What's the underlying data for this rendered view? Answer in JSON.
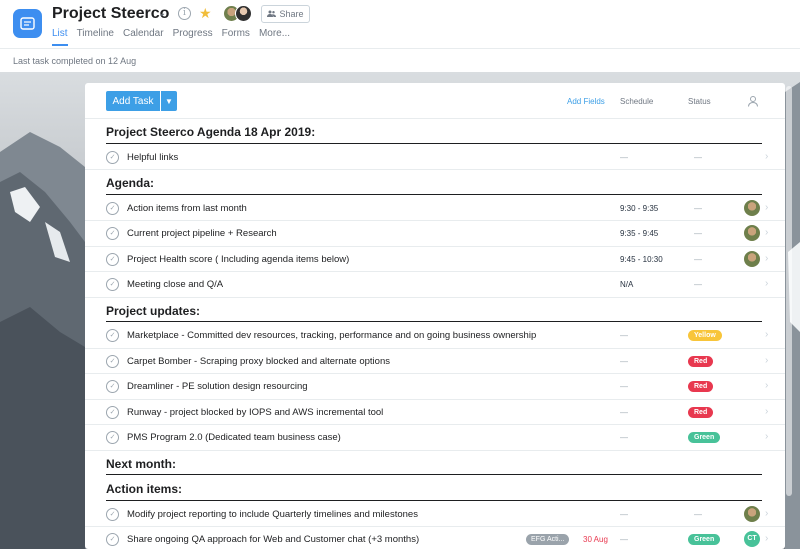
{
  "header": {
    "title": "Project Steerco",
    "share_label": "Share",
    "tabs": [
      {
        "label": "List"
      },
      {
        "label": "Timeline"
      },
      {
        "label": "Calendar"
      },
      {
        "label": "Progress"
      },
      {
        "label": "Forms"
      },
      {
        "label": "More..."
      }
    ],
    "active_tab": "List"
  },
  "subbar": {
    "last_completed": "Last task completed on 12 Aug"
  },
  "toolbar": {
    "add_task_label": "Add Task",
    "add_fields_label": "Add Fields",
    "schedule_label": "Schedule",
    "status_label": "Status"
  },
  "icons": {
    "app": "list-icon",
    "title_dropdown": "chevron-down-icon",
    "info": "info-icon",
    "favorite": "star-icon",
    "share": "people-icon",
    "assignee_header": "person-icon",
    "row_check": "check-icon",
    "row_details": "chevron-right-icon"
  },
  "colors": {
    "accent": "#3d8ef0",
    "button": "#3d9fe6",
    "yellow": "#f8c53a",
    "red": "#e8384f",
    "green": "#48c299"
  },
  "rows": [
    {
      "type": "section",
      "title": "Project Steerco Agenda 18 Apr 2019:"
    },
    {
      "type": "task",
      "name": "Helpful links",
      "schedule": "—",
      "status": "—"
    },
    {
      "type": "section",
      "title": "Agenda:"
    },
    {
      "type": "task",
      "name": "Action items from last month",
      "schedule": "9:30 - 9:35",
      "status": "—",
      "avatar": "photo"
    },
    {
      "type": "task",
      "name": "Current project pipeline + Research",
      "schedule": "9:35 - 9:45",
      "status": "—",
      "avatar": "photo"
    },
    {
      "type": "task",
      "name": "Project Health score ( Including agenda items below)",
      "schedule": "9:45 - 10:30",
      "status": "—",
      "avatar": "photo"
    },
    {
      "type": "task",
      "name": "Meeting close and Q/A",
      "schedule": "N/A",
      "status": "—"
    },
    {
      "type": "section",
      "title": "Project updates:"
    },
    {
      "type": "task",
      "name": "Marketplace - Committed dev resources, tracking, performance and on going business ownership",
      "schedule": "—",
      "status_pill": "Yellow",
      "pill_color": "yellow"
    },
    {
      "type": "task",
      "name": "Carpet Bomber - Scraping proxy blocked and alternate options",
      "schedule": "—",
      "status_pill": "Red",
      "pill_color": "red"
    },
    {
      "type": "task",
      "name": "Dreamliner - PE solution design resourcing",
      "schedule": "—",
      "status_pill": "Red",
      "pill_color": "red"
    },
    {
      "type": "task",
      "name": "Runway - project blocked by IOPS and AWS incremental tool",
      "schedule": "—",
      "status_pill": "Red",
      "pill_color": "red"
    },
    {
      "type": "task",
      "name": "PMS Program 2.0 (Dedicated team business case)",
      "schedule": "—",
      "status_pill": "Green",
      "pill_color": "green"
    },
    {
      "type": "section",
      "title": "Next month:"
    },
    {
      "type": "section",
      "title": "Action items:"
    },
    {
      "type": "task",
      "name": "Modify project reporting to include Quarterly timelines and milestones",
      "schedule": "—",
      "status": "—",
      "avatar": "photo"
    },
    {
      "type": "task",
      "name": "Share ongoing QA approach for Web and Customer chat (+3 months)",
      "tag": "EFG Acti...",
      "due": "30 Aug",
      "schedule": "—",
      "status_pill": "Green",
      "pill_color": "green",
      "avatar_initials": "CT"
    }
  ]
}
